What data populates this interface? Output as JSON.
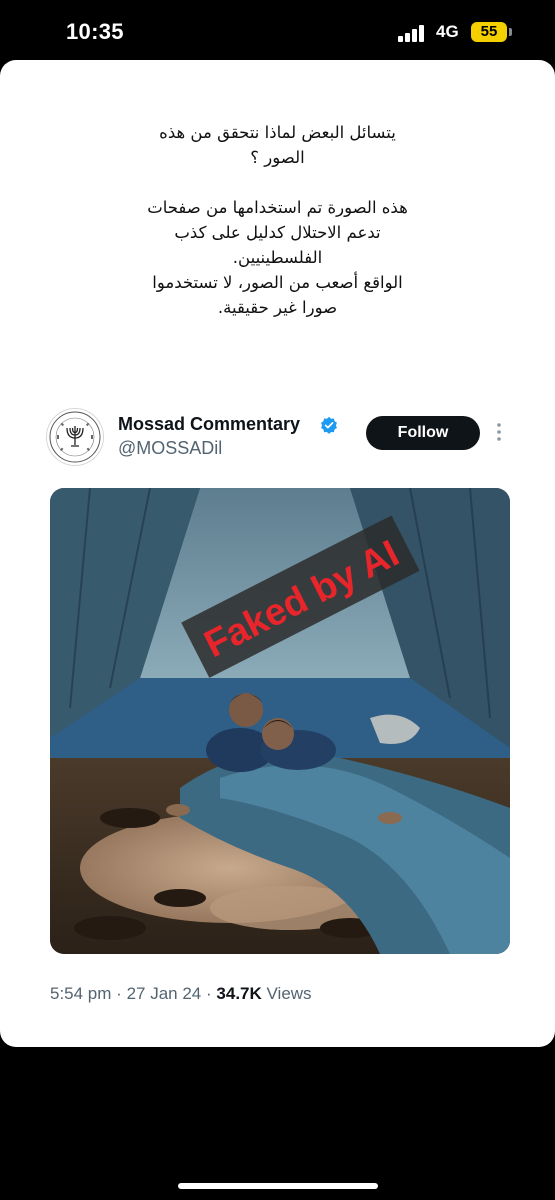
{
  "status_bar": {
    "time": "10:35",
    "network": "4G",
    "battery": "55"
  },
  "post": {
    "paragraph1": [
      "يتسائل البعض لماذا نتحقق من هذه",
      "الصور ؟"
    ],
    "paragraph2": [
      "هذه الصورة تم استخدامها من صفحات",
      "تدعم الاحتلال كدليل على كذب",
      "الفلسطينيين.",
      "الواقع أصعب من الصور، لا تستخدموا",
      "صورا غير حقيقية."
    ]
  },
  "tweet": {
    "display_name": "Mossad Commentary",
    "handle": "@MOSSADil",
    "follow_label": "Follow",
    "media_stamp": "Faked by AI",
    "time": "5:54 pm",
    "separator": "·",
    "date": "27 Jan 24",
    "views_count": "34.7K",
    "views_label": "Views"
  },
  "colors": {
    "verified": "#1d9bf0",
    "follow_bg": "#0f1419",
    "stamp": "#e8252b",
    "battery": "#f5d000"
  }
}
